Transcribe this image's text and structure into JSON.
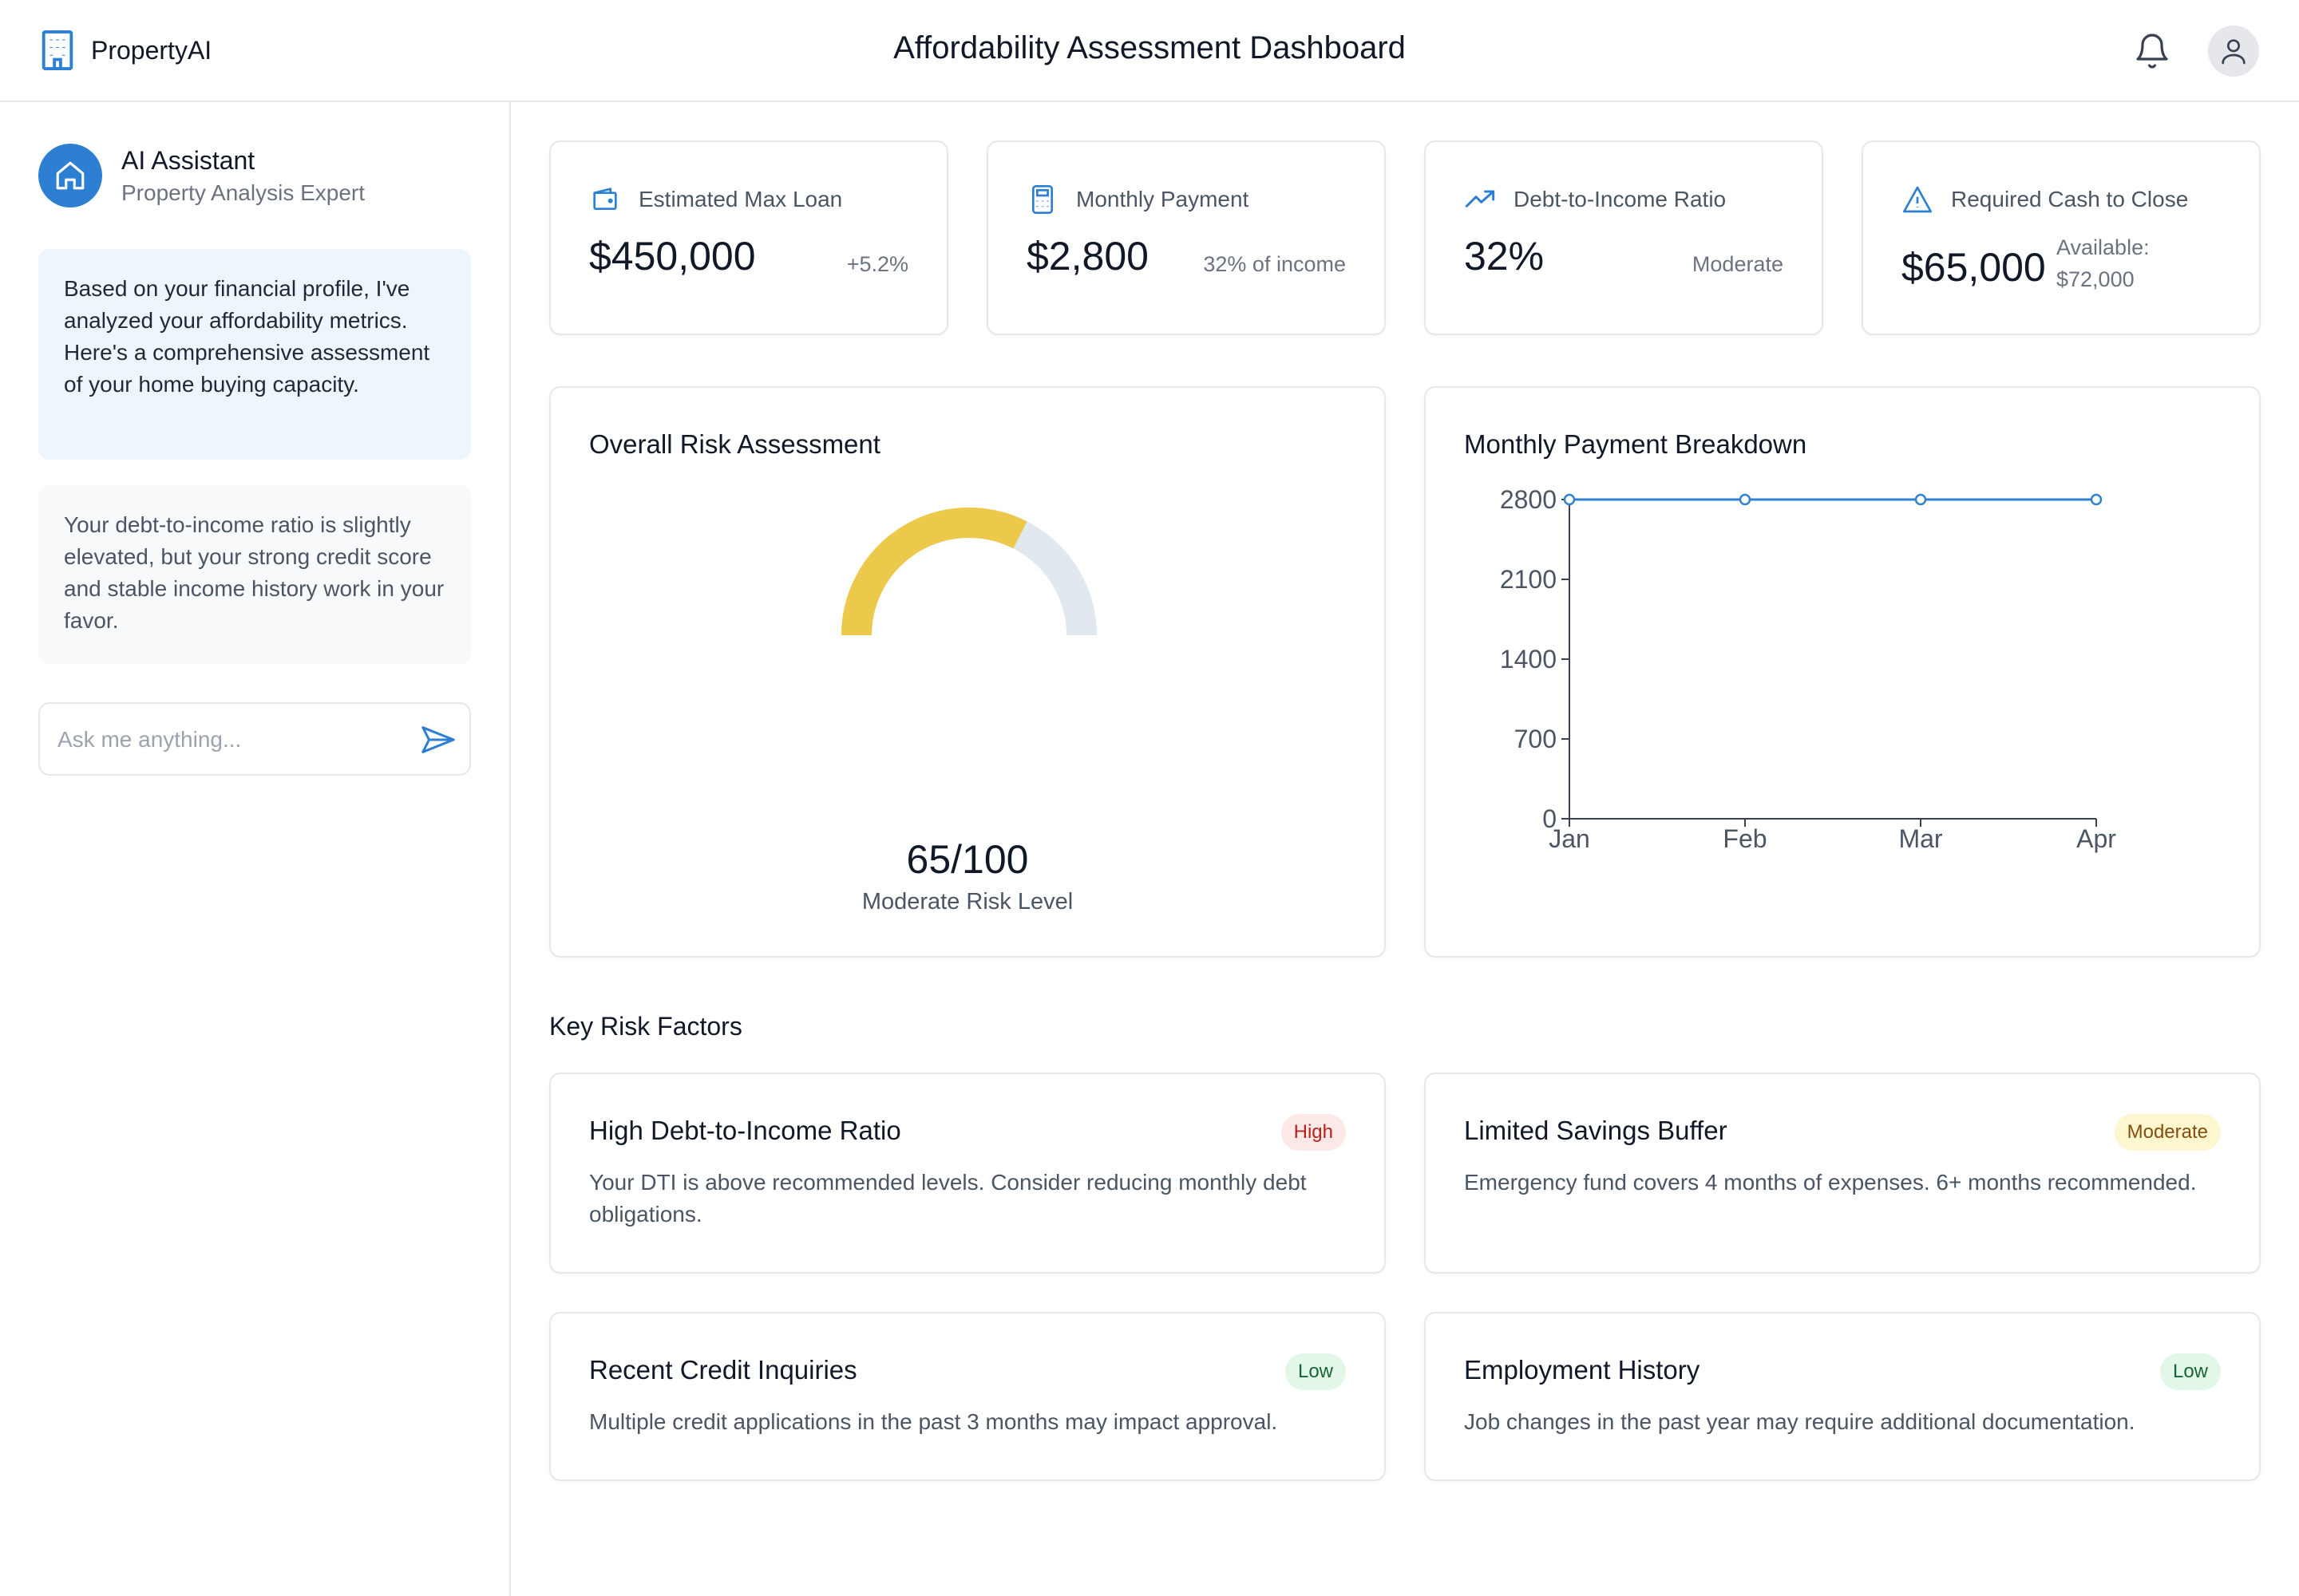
{
  "header": {
    "brand": "PropertyAI",
    "title": "Affordability Assessment Dashboard",
    "icons": [
      "building-icon",
      "bell-icon",
      "user-icon"
    ]
  },
  "sidebar": {
    "assistant_name": "AI Assistant",
    "assistant_role": "Property Analysis Expert",
    "messages": [
      "Based on your financial profile, I've analyzed your affordability metrics. Here's a comprehensive assessment of your home buying capacity.",
      "Your debt-to-income ratio is slightly elevated, but your strong credit score and stable income history work in your favor."
    ],
    "input_placeholder": "Ask me anything...",
    "input_value": ""
  },
  "stats": [
    {
      "label": "Estimated Max Loan",
      "value": "$450,000",
      "sub": "+5.2%",
      "icon": "wallet-icon"
    },
    {
      "label": "Monthly Payment",
      "value": "$2,800",
      "sub": "32% of income",
      "icon": "calculator-icon"
    },
    {
      "label": "Debt-to-Income Ratio",
      "value": "32%",
      "sub": "Moderate",
      "icon": "trending-up-icon"
    },
    {
      "label": "Required Cash to Close",
      "value": "$65,000",
      "sub": "Available: $72,000",
      "icon": "alert-triangle-icon"
    }
  ],
  "risk_panel": {
    "title": "Overall Risk Assessment",
    "score": "65/100",
    "level": "Moderate Risk Level",
    "gauge_fraction": 0.65,
    "gauge_color": "#ecc94b",
    "gauge_track_color": "#e2e8f0"
  },
  "chart_data": {
    "type": "line",
    "title": "Monthly Payment Breakdown",
    "categories": [
      "Jan",
      "Feb",
      "Mar",
      "Apr"
    ],
    "series": [
      {
        "values": [
          2800,
          2800,
          2800,
          2800
        ]
      }
    ],
    "yticks": [
      0,
      700,
      1400,
      2100,
      2800
    ],
    "ylim": [
      0,
      2800
    ],
    "grid": false,
    "line_color": "#3182ce"
  },
  "risk_factors": {
    "title": "Key Risk Factors",
    "items": [
      {
        "title": "High Debt-to-Income Ratio",
        "badge": "High",
        "desc": "Your DTI is above recommended levels. Consider reducing monthly debt obligations."
      },
      {
        "title": "Limited Savings Buffer",
        "badge": "Moderate",
        "desc": "Emergency fund covers 4 months of expenses. 6+ months recommended."
      },
      {
        "title": "Recent Credit Inquiries",
        "badge": "Low",
        "desc": "Multiple credit applications in the past 3 months may impact approval."
      },
      {
        "title": "Employment History",
        "badge": "Low",
        "desc": "Job changes in the past year may require additional documentation."
      }
    ]
  }
}
